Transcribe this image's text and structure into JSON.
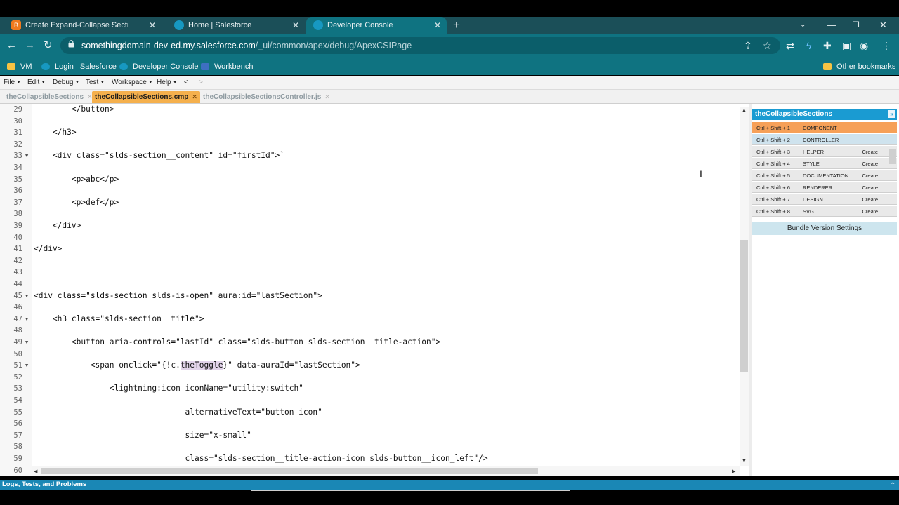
{
  "browser": {
    "tabs": [
      {
        "title": "Create Expand-Collapse Sections",
        "favicon": "blogger-icon",
        "color": "#f07a1e"
      },
      {
        "title": "Home | Salesforce",
        "favicon": "salesforce-cloud-icon",
        "color": "#1798c1"
      },
      {
        "title": "Developer Console",
        "favicon": "salesforce-cloud-icon",
        "color": "#1798c1"
      }
    ],
    "new_tab": "+",
    "url_host": "somethingdomain-dev-ed.my.salesforce.com",
    "url_path": "/_ui/common/apex/debug/ApexCSIPage",
    "bookmarks": [
      {
        "label": "VM",
        "icon": "folder-icon"
      },
      {
        "label": "Login | Salesforce",
        "icon": "salesforce-cloud-icon"
      },
      {
        "label": "Developer Console",
        "icon": "salesforce-cloud-icon"
      },
      {
        "label": "Workbench",
        "icon": "workbench-icon"
      }
    ],
    "other_bookmarks": "Other bookmarks"
  },
  "console": {
    "menus": [
      "File",
      "Edit",
      "Debug",
      "Test",
      "Workspace",
      "Help"
    ],
    "nav_back": "<",
    "nav_fwd": ">",
    "file_tabs": [
      {
        "label": "theCollapsibleSections",
        "active": false
      },
      {
        "label": "theCollapsibleSections.cmp",
        "active": true
      },
      {
        "label": "theCollapsibleSectionsController.js",
        "active": false
      }
    ],
    "code_lines": [
      {
        "n": "29",
        "text": "        </button>",
        "fold": false
      },
      {
        "n": "30",
        "text": "",
        "fold": false
      },
      {
        "n": "31",
        "text": "    </h3>",
        "fold": false
      },
      {
        "n": "32",
        "text": "",
        "fold": false
      },
      {
        "n": "33",
        "text": "    <div class=\"slds-section__content\" id=\"firstId\">`",
        "fold": true
      },
      {
        "n": "34",
        "text": "",
        "fold": false
      },
      {
        "n": "35",
        "text": "        <p>abc</p>",
        "fold": false
      },
      {
        "n": "36",
        "text": "",
        "fold": false
      },
      {
        "n": "37",
        "text": "        <p>def</p>",
        "fold": false
      },
      {
        "n": "38",
        "text": "",
        "fold": false
      },
      {
        "n": "39",
        "text": "    </div>",
        "fold": false
      },
      {
        "n": "40",
        "text": "",
        "fold": false
      },
      {
        "n": "41",
        "text": "</div>",
        "fold": false
      },
      {
        "n": "42",
        "text": "",
        "fold": false
      },
      {
        "n": "43",
        "text": "",
        "fold": false
      },
      {
        "n": "44",
        "text": "",
        "fold": false
      },
      {
        "n": "45",
        "text": "<div class=\"slds-section slds-is-open\" aura:id=\"lastSection\">",
        "fold": true
      },
      {
        "n": "46",
        "text": "",
        "fold": false
      },
      {
        "n": "47",
        "text": "    <h3 class=\"slds-section__title\">",
        "fold": true
      },
      {
        "n": "48",
        "text": "",
        "fold": false
      },
      {
        "n": "49",
        "text": "        <button aria-controls=\"lastId\" class=\"slds-button slds-section__title-action\">",
        "fold": true
      },
      {
        "n": "50",
        "text": "",
        "fold": false
      },
      {
        "n": "51",
        "pre": "            <span onclick=\"{!c.",
        "hl": "theToggle",
        "post": "}\" data-auraId=\"lastSection\">",
        "fold": true
      },
      {
        "n": "52",
        "text": "",
        "fold": false
      },
      {
        "n": "53",
        "text": "                <lightning:icon iconName=\"utility:switch\"",
        "fold": false
      },
      {
        "n": "54",
        "text": "",
        "fold": false
      },
      {
        "n": "55",
        "text": "                                alternativeText=\"button icon\"",
        "fold": false
      },
      {
        "n": "56",
        "text": "",
        "fold": false
      },
      {
        "n": "57",
        "text": "                                size=\"x-small\"",
        "fold": false
      },
      {
        "n": "58",
        "text": "",
        "fold": false
      },
      {
        "n": "59",
        "text": "                                class=\"slds-section__title-action-icon slds-button__icon_left\"/>",
        "fold": false
      },
      {
        "n": "60",
        "text": "",
        "fold": false
      }
    ],
    "bundle": {
      "title": "theCollapsibleSections",
      "rows": [
        {
          "keys": "Ctrl + Shift + 1",
          "name": "COMPONENT",
          "action": ""
        },
        {
          "keys": "Ctrl + Shift + 2",
          "name": "CONTROLLER",
          "action": ""
        },
        {
          "keys": "Ctrl + Shift + 3",
          "name": "HELPER",
          "action": "Create"
        },
        {
          "keys": "Ctrl + Shift + 4",
          "name": "STYLE",
          "action": "Create"
        },
        {
          "keys": "Ctrl + Shift + 5",
          "name": "DOCUMENTATION",
          "action": "Create"
        },
        {
          "keys": "Ctrl + Shift + 6",
          "name": "RENDERER",
          "action": "Create"
        },
        {
          "keys": "Ctrl + Shift + 7",
          "name": "DESIGN",
          "action": "Create"
        },
        {
          "keys": "Ctrl + Shift + 8",
          "name": "SVG",
          "action": "Create"
        }
      ],
      "version_settings": "Bundle Version Settings"
    },
    "status_bar": "Logs, Tests, and Problems"
  }
}
